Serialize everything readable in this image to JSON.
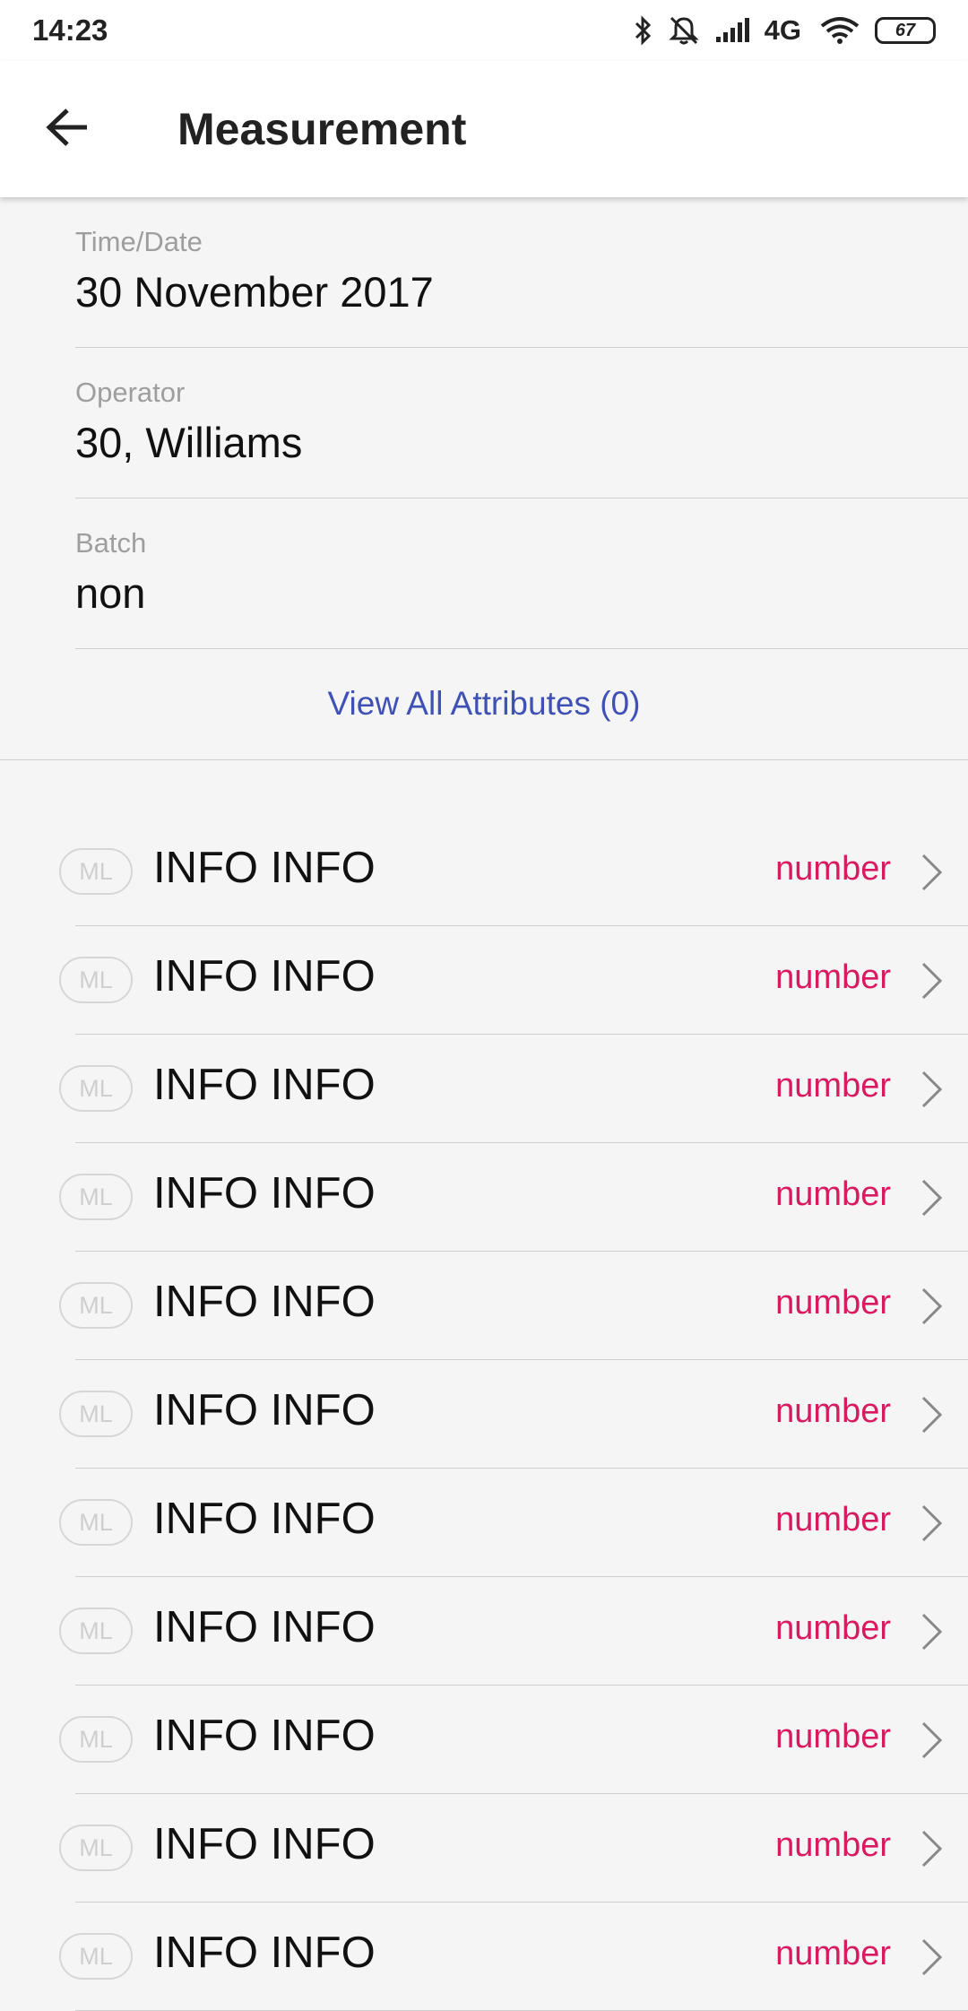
{
  "status_bar": {
    "time": "14:23",
    "network": "4G",
    "battery": "67",
    "icons": [
      "bluetooth-icon",
      "muted-bell-icon",
      "signal-icon",
      "wifi-icon",
      "battery-icon"
    ]
  },
  "app_bar": {
    "title": "Measurement",
    "back_icon": "arrow-left-icon"
  },
  "fields": [
    {
      "label": "Time/Date",
      "value": "30 November 2017"
    },
    {
      "label": "Operator",
      "value": "30, Williams"
    },
    {
      "label": "Batch",
      "value": "non"
    }
  ],
  "view_all": "View All Attributes (0)",
  "list": [
    {
      "badge": "ML",
      "label": "INFO INFO",
      "value": "number"
    },
    {
      "badge": "ML",
      "label": "INFO INFO",
      "value": "number"
    },
    {
      "badge": "ML",
      "label": "INFO INFO",
      "value": "number"
    },
    {
      "badge": "ML",
      "label": "INFO INFO",
      "value": "number"
    },
    {
      "badge": "ML",
      "label": "INFO INFO",
      "value": "number"
    },
    {
      "badge": "ML",
      "label": "INFO INFO",
      "value": "number"
    },
    {
      "badge": "ML",
      "label": "INFO INFO",
      "value": "number"
    },
    {
      "badge": "ML",
      "label": "INFO INFO",
      "value": "number"
    },
    {
      "badge": "ML",
      "label": "INFO INFO",
      "value": "number"
    },
    {
      "badge": "ML",
      "label": "INFO INFO",
      "value": "number"
    },
    {
      "badge": "ML",
      "label": "INFO INFO",
      "value": "number"
    }
  ],
  "colors": {
    "accent_link": "#3f51b5",
    "value_text": "#d81b60"
  }
}
